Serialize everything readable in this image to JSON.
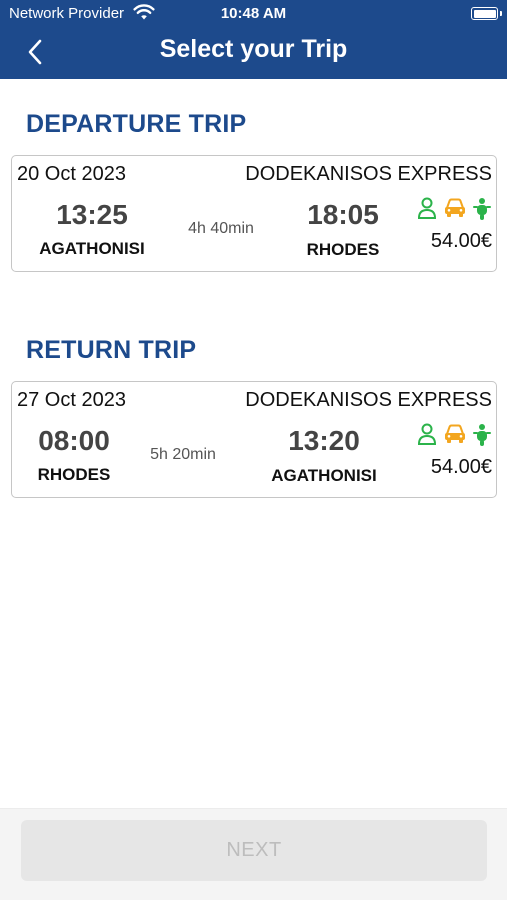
{
  "status_bar": {
    "carrier": "Network Provider",
    "time": "10:48 AM"
  },
  "header": {
    "title": "Select your Trip"
  },
  "departure": {
    "section_title": "DEPARTURE TRIP",
    "date": "20 Oct 2023",
    "operator": "DODEKANISOS EXPRESS",
    "depart_time": "13:25",
    "depart_port": "AGATHONISI",
    "duration": "4h 40min",
    "arrive_time": "18:05",
    "arrive_port": "RHODES",
    "price": "54.00€",
    "icons": [
      "person-icon",
      "car-icon",
      "motorbike-icon"
    ]
  },
  "return": {
    "section_title": "RETURN TRIP",
    "date": "27 Oct 2023",
    "operator": "DODEKANISOS EXPRESS",
    "depart_time": "08:00",
    "depart_port": "RHODES",
    "duration": "5h 20min",
    "arrive_time": "13:20",
    "arrive_port": "AGATHONISI",
    "price": "54.00€",
    "icons": [
      "person-icon",
      "car-icon",
      "motorbike-icon"
    ]
  },
  "footer": {
    "next_label": "NEXT"
  },
  "colors": {
    "brand_blue": "#1d4a8c",
    "passenger_green": "#2bb34a",
    "vehicle_orange": "#f3a61f",
    "disabled_button": "#e6e6e6"
  }
}
